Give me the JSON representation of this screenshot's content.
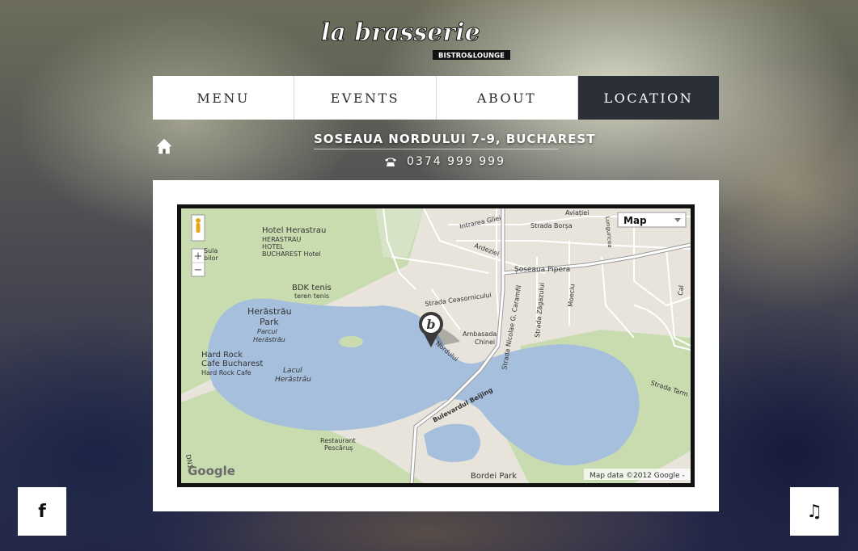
{
  "brand": {
    "logo_main": "la brasserie",
    "logo_sub": "BISTRO&LOUNGE"
  },
  "nav": [
    {
      "label": "MENU",
      "active": false
    },
    {
      "label": "EVENTS",
      "active": false
    },
    {
      "label": "ABOUT",
      "active": false
    },
    {
      "label": "LOCATION",
      "active": true
    }
  ],
  "location": {
    "address": "SOSEAUA NORDULUI 7-9, BUCHAREST",
    "phone": "0374 999 999"
  },
  "map": {
    "type_label": "Map",
    "zoom_in": "+",
    "zoom_out": "−",
    "attribution": "Map data ©2012 Google -",
    "google_logo": "Google",
    "labels": {
      "hotel": "Hotel Herastrau",
      "hotel2": "HERASTRAU",
      "hotel3": "HOTEL",
      "hotel4": "BUCHAREST Hotel",
      "bdk": "BDK tenis",
      "bdk2": "teren tenis",
      "park": "Herăstrău",
      "park2": "Park",
      "park3": "Parcul",
      "park4": "Herăstrău",
      "lake": "Lacul",
      "lake2": "Herăstrău",
      "hardrock": "Hard Rock",
      "hardrock2": "Cafe Bucharest",
      "hardrock3": "Hard Rock Cafe",
      "restaurant": "Restaurant",
      "restaurant2": "Pescăruș",
      "bordei": "Bordei Park",
      "ambasada": "Ambasada",
      "ambasada2": "Chinei",
      "pipera": "Șoseaua Pipera",
      "borsa": "Strada Borșa",
      "aviatiei": "Aviației",
      "intrarea": "Intrarea Gliei",
      "ardezie": "Ardeziei",
      "ceasornic": "Strada Ceasornicului",
      "caramfil": "Strada Nicolae G. Caramfil",
      "zagazului": "Strada Zăgazului",
      "moeciu": "Moeciu",
      "beijing": "Bulevardul Beijing",
      "tarmului": "Strada Tarm",
      "nordului": "Nordului",
      "sula": "Sula",
      "bilor": "bilor",
      "dn": "DN1",
      "cal": "Cal",
      "lunguricea": "Lunguricea"
    }
  },
  "social": {
    "facebook": "f",
    "music": "♫"
  },
  "colors": {
    "active_nav": "#2b3038",
    "water": "#a5bfdd",
    "park": "#c8dcb0",
    "land": "#e8e4dc"
  }
}
